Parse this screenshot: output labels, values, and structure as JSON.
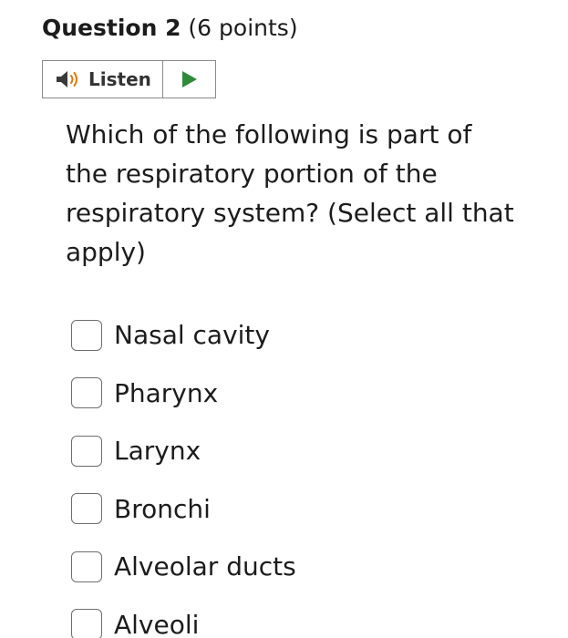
{
  "question": {
    "title": "Question 2",
    "points": " (6 points)",
    "text": "Which of the following is part of the respiratory portion of the respiratory system? (Select all that apply)"
  },
  "listen": {
    "label": "Listen",
    "speaker_icon": "speaker-icon",
    "play_icon": "play-icon",
    "accent": "#2e8b3a"
  },
  "options": [
    {
      "label": "Nasal cavity",
      "checked": false
    },
    {
      "label": "Pharynx",
      "checked": false
    },
    {
      "label": "Larynx",
      "checked": false
    },
    {
      "label": "Bronchi",
      "checked": false
    },
    {
      "label": "Alveolar ducts",
      "checked": false
    },
    {
      "label": "Alveoli",
      "checked": false
    }
  ]
}
